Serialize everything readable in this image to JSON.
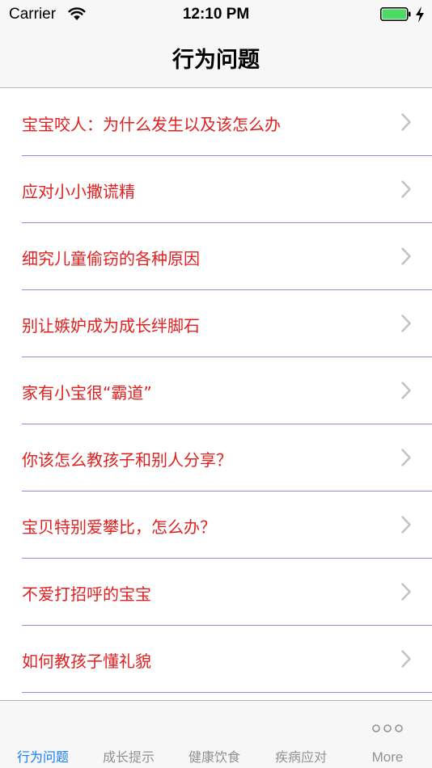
{
  "status_bar": {
    "carrier": "Carrier",
    "time": "12:10 PM"
  },
  "nav": {
    "title": "行为问题"
  },
  "list": {
    "items": [
      {
        "label": "宝宝咬人：为什么发生以及该怎么办"
      },
      {
        "label": "应对小小撒谎精"
      },
      {
        "label": "细究儿童偷窃的各种原因"
      },
      {
        "label": "别让嫉妒成为成长绊脚石"
      },
      {
        "label": "家有小宝很“霸道”"
      },
      {
        "label": "你该怎么教孩子和别人分享？"
      },
      {
        "label": "宝贝特别爱攀比，怎么办？"
      },
      {
        "label": "不爱打招呼的宝宝"
      },
      {
        "label": "如何教孩子懂礼貌"
      }
    ]
  },
  "tabbar": {
    "tabs": [
      {
        "label": "行为问题",
        "active": true
      },
      {
        "label": "成长提示",
        "active": false
      },
      {
        "label": "健康饮食",
        "active": false
      },
      {
        "label": "疾病应对",
        "active": false
      },
      {
        "label": "More",
        "active": false
      }
    ]
  },
  "colors": {
    "accent": "#147efb",
    "item_text": "#e02020",
    "separator": "#8b8fe6",
    "battery": "#4cd964"
  },
  "icons": {
    "wifi": "wifi-icon",
    "battery": "battery-icon",
    "charging": "charging-bolt-icon",
    "chevron": "chevron-right-icon",
    "more": "more-dots-icon"
  }
}
